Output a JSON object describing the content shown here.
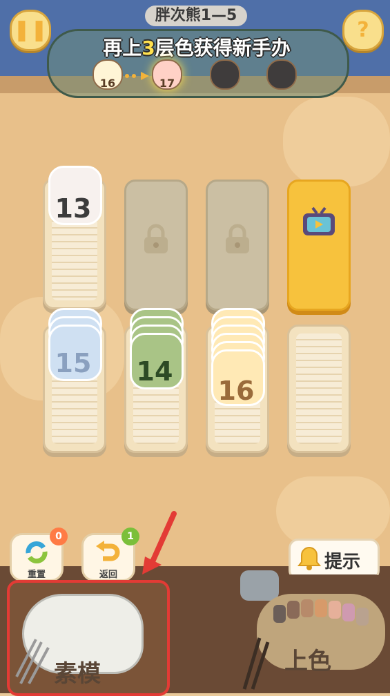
{
  "header": {
    "level_title": "胖次熊1—5",
    "goal_prefix": "再上",
    "goal_count": "3",
    "goal_suffix": "层色获得新手办",
    "goal_steps": [
      {
        "number": "16",
        "color": "#fff5d6",
        "state": "done"
      },
      {
        "number": "17",
        "color": "#ffd1c6",
        "state": "current"
      },
      {
        "number": "",
        "color": "#3f3c3c",
        "state": "locked"
      },
      {
        "number": "",
        "color": "#3f3c3c",
        "state": "locked"
      }
    ]
  },
  "columns_top": [
    {
      "type": "stack",
      "bear_number": "13",
      "bear_color": "#f7f1ee",
      "num_color": "#3c3c3c"
    },
    {
      "type": "locked"
    },
    {
      "type": "locked"
    },
    {
      "type": "video"
    }
  ],
  "columns_bottom": [
    {
      "type": "stack",
      "bear_number": "15",
      "bear_color": "#cfe0f2",
      "num_color": "#8aa0bf",
      "layers": 3
    },
    {
      "type": "stack",
      "bear_number": "14",
      "bear_color": "#a9c486",
      "num_color": "#2d4a25",
      "layers": 4
    },
    {
      "type": "stack",
      "bear_number": "16",
      "bear_color": "#ffe9b5",
      "num_color": "#9a6b3b",
      "layers": 6
    },
    {
      "type": "empty"
    }
  ],
  "tools": {
    "reset": {
      "label": "重置",
      "badge": "0",
      "badge_color": "#ff7b45"
    },
    "undo": {
      "label": "返回",
      "badge": "1",
      "badge_color": "#7bbf3a"
    }
  },
  "hint_label": "提示",
  "sketch_label": "素模",
  "color_label": "上色",
  "colors": {
    "highlight_border": "#e33b35",
    "accent_yellow": "#ffe14f"
  }
}
